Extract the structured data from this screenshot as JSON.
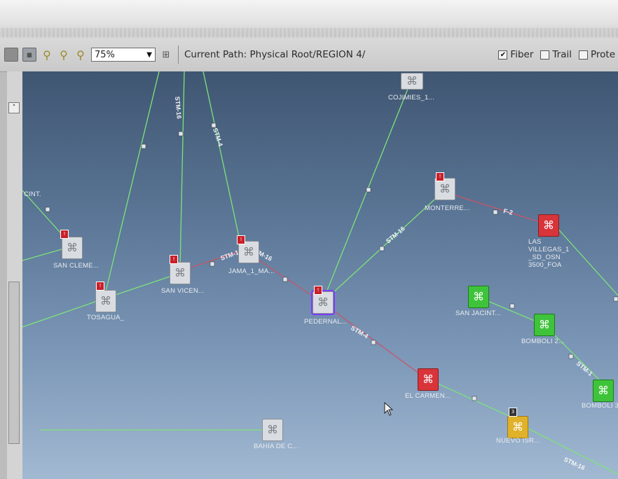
{
  "toolbar": {
    "zoom_value": "75%",
    "current_path": "Current Path: Physical Root/REGION 4/",
    "checkboxes": [
      {
        "label": "Fiber",
        "checked": true
      },
      {
        "label": "Trail",
        "checked": false
      },
      {
        "label": "Prote",
        "checked": false
      }
    ]
  },
  "map": {
    "nodes": {
      "cojimies": "COJIMIES_1...",
      "cint": "CINT.",
      "san_cleme": "SAN CLEME...",
      "tosagua": "TOSAGUA_",
      "san_vicen": "SAN VICEN...",
      "jama": "JAMA_1_MA...",
      "pedernal": "PEDERNAL...",
      "monterre": "MONTERRE...",
      "las_villegas": "LAS\nVILLEGAS_1\n_SD_OSN\n3500_FOA",
      "san_jacint": "SAN JACINT...",
      "bomboli_2": "BOMBOLI 2...",
      "bomboli_3": "BOMBOLI 3",
      "el_carmen": "EL CARMEN...",
      "nuevo_isr": "NUEVO ISR...",
      "bahia": "BAHIA DE C..."
    },
    "link_labels": {
      "l1": "STM-16",
      "l2": "STM-4",
      "l3": "STM-16",
      "l4": "STM-16",
      "l5": "STM-16",
      "l6": "STM-4",
      "l7": "F-2",
      "l8": "STM-1",
      "l9": "STM-16"
    },
    "colors": {
      "fiber_green": "#7de37a",
      "link_red": "#c8556a",
      "node_red": "#d8343a",
      "node_green": "#3fc33a",
      "selected": "#7a3dff"
    }
  }
}
